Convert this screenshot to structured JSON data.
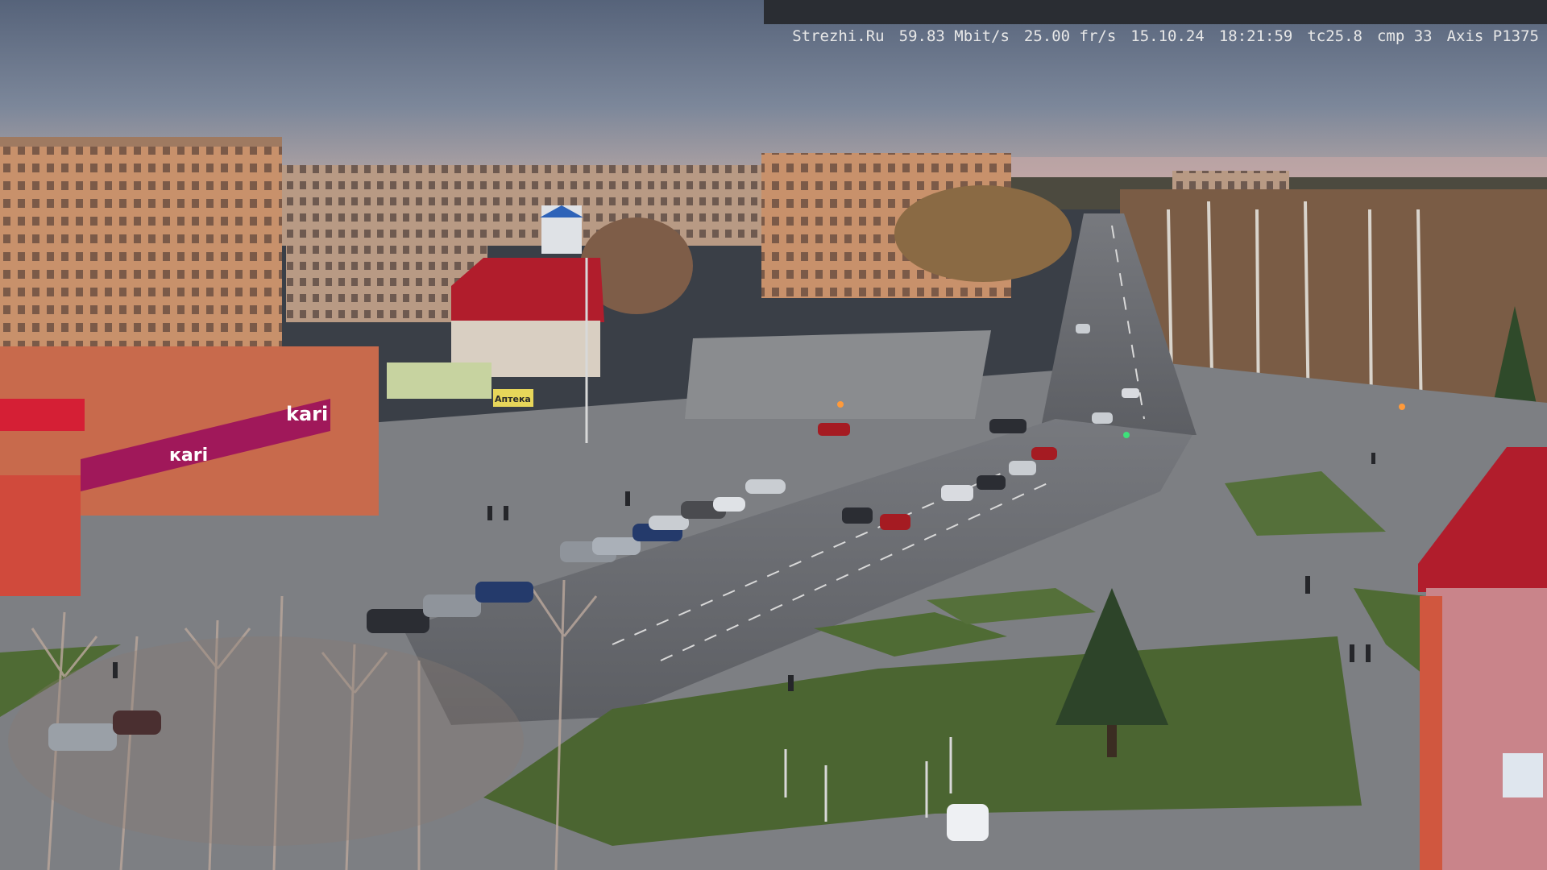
{
  "camera_overlay": {
    "site": "Strezhi.Ru",
    "bitrate": "59.83 Mbit/s",
    "framerate": "25.00 fr/s",
    "date": "15.10.24",
    "time": "18:21:59",
    "tc": "tc25.8",
    "cmp": "cmp 33",
    "model": "Axis P1375"
  },
  "signs": {
    "store_brand": "kari",
    "store_banner": "кari",
    "pharmacy": "Аптека"
  },
  "colors": {
    "sky_top": "#5d6b80",
    "sky_horizon": "#9aa3b3",
    "brick": "#c8916b",
    "kari_magenta": "#a0185a",
    "roof_red": "#b11d2c",
    "grass": "#4f6b34",
    "asphalt": "#6b6d72"
  }
}
